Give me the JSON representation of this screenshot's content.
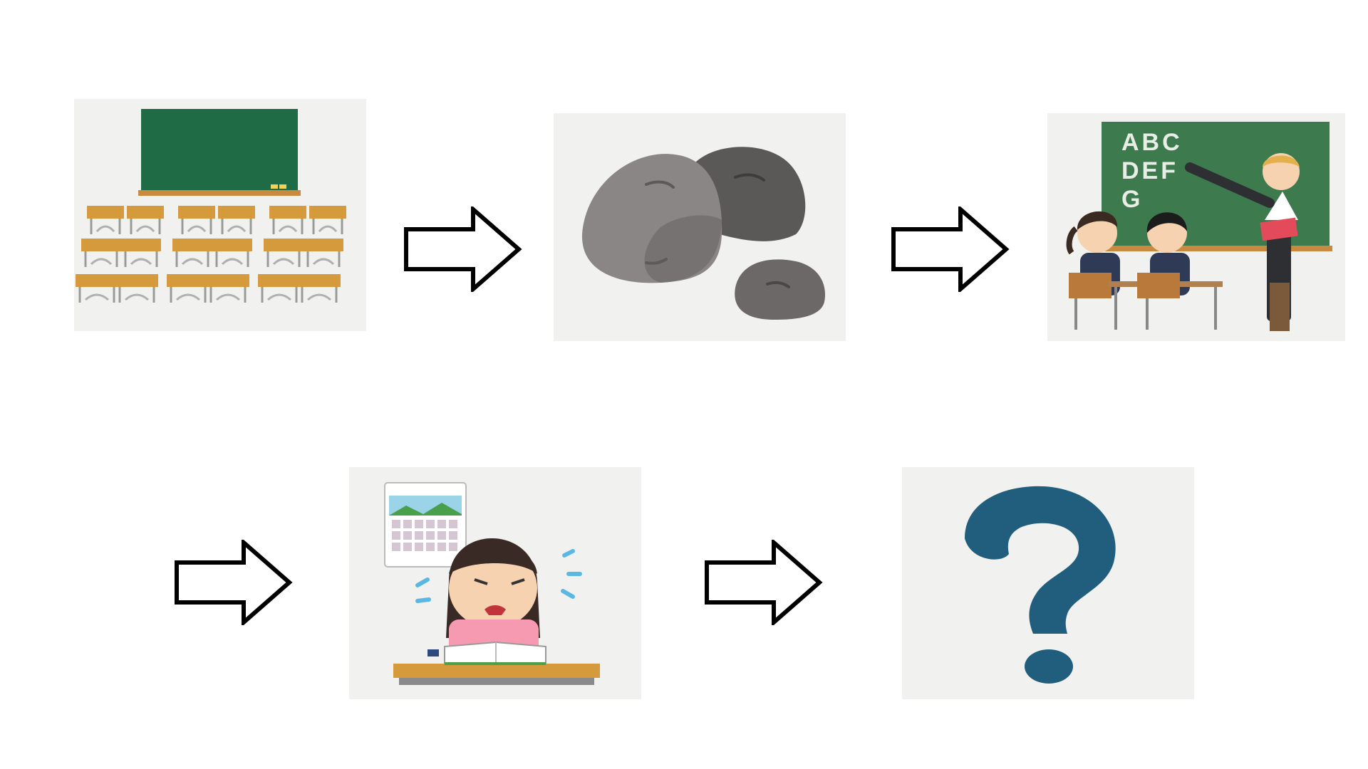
{
  "flow": {
    "steps": [
      {
        "id": "empty-classroom",
        "icon": "classroom-illustration"
      },
      {
        "id": "rocks",
        "icon": "rocks-illustration"
      },
      {
        "id": "lesson",
        "icon": "teacher-lesson-illustration"
      },
      {
        "id": "studying",
        "icon": "student-studying-illustration"
      },
      {
        "id": "unknown",
        "icon": "question-mark-illustration"
      }
    ],
    "arrow_icon": "right-outline-arrow-icon"
  },
  "blackboard": {
    "line1": "ABC",
    "line2": "DEF",
    "line3": "G"
  },
  "colors": {
    "card_bg": "#f1f1f0",
    "blackboard_green": "#1f6b45",
    "desk_wood": "#d59a3c",
    "rock_gray": "#7d7a78",
    "question_blue": "#215e7d"
  }
}
